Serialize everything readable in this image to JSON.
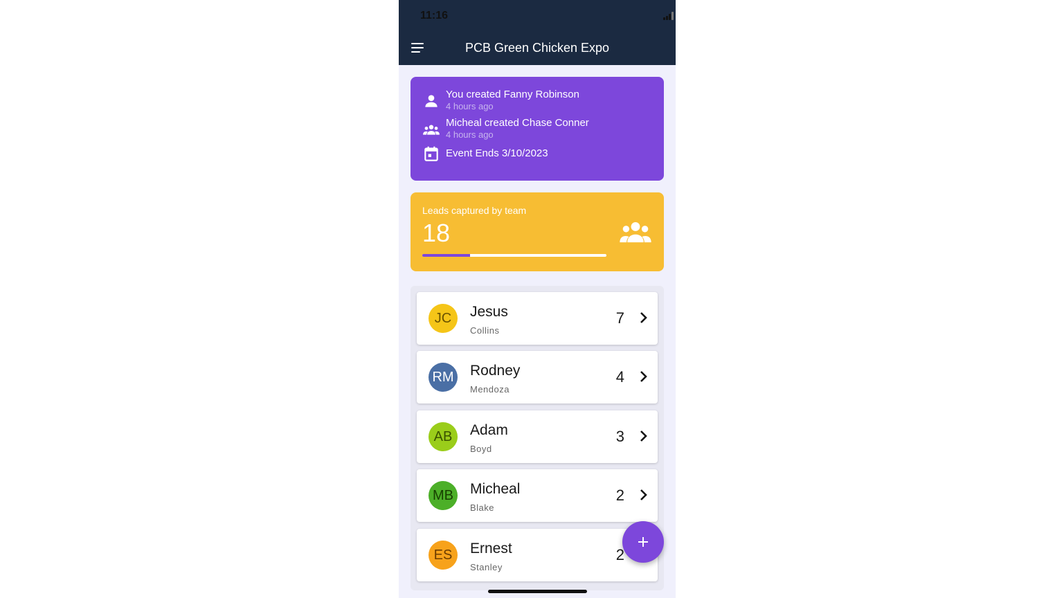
{
  "status_bar": {
    "time": "11:16"
  },
  "app_bar": {
    "title": "PCB Green Chicken Expo",
    "menu_icon": "hamburger-menu-icon"
  },
  "activity": {
    "items": [
      {
        "icon": "person-icon",
        "text": "You created Fanny Robinson",
        "time": "4 hours ago"
      },
      {
        "icon": "group-icon",
        "text": "Micheal created Chase Conner",
        "time": "4 hours ago"
      },
      {
        "icon": "calendar-icon",
        "text": "Event Ends 3/10/2023"
      }
    ]
  },
  "leads": {
    "label": "Leads captured by team",
    "count": "18",
    "progress": 0.26,
    "icon": "group-icon"
  },
  "members": [
    {
      "initials": "JC",
      "first": "Jesus",
      "last": "Collins",
      "count": "7",
      "color": "#f5c518",
      "text_color": "#6b5300"
    },
    {
      "initials": "RM",
      "first": "Rodney",
      "last": "Mendoza",
      "count": "4",
      "color": "#4a6fa5",
      "text_color": "#ffffff"
    },
    {
      "initials": "AB",
      "first": "Adam",
      "last": "Boyd",
      "count": "3",
      "color": "#9acd1a",
      "text_color": "#3a5200"
    },
    {
      "initials": "MB",
      "first": "Micheal",
      "last": "Blake",
      "count": "2",
      "color": "#4caf28",
      "text_color": "#173f00"
    },
    {
      "initials": "ES",
      "first": "Ernest",
      "last": "Stanley",
      "count": "2",
      "color": "#f7a21b",
      "text_color": "#6b3c00"
    }
  ],
  "fab": {
    "icon": "plus-icon"
  },
  "colors": {
    "header": "#1b2a41",
    "activity_card": "#7d47db",
    "leads_card": "#f7bd33",
    "accent": "#7d47db"
  }
}
